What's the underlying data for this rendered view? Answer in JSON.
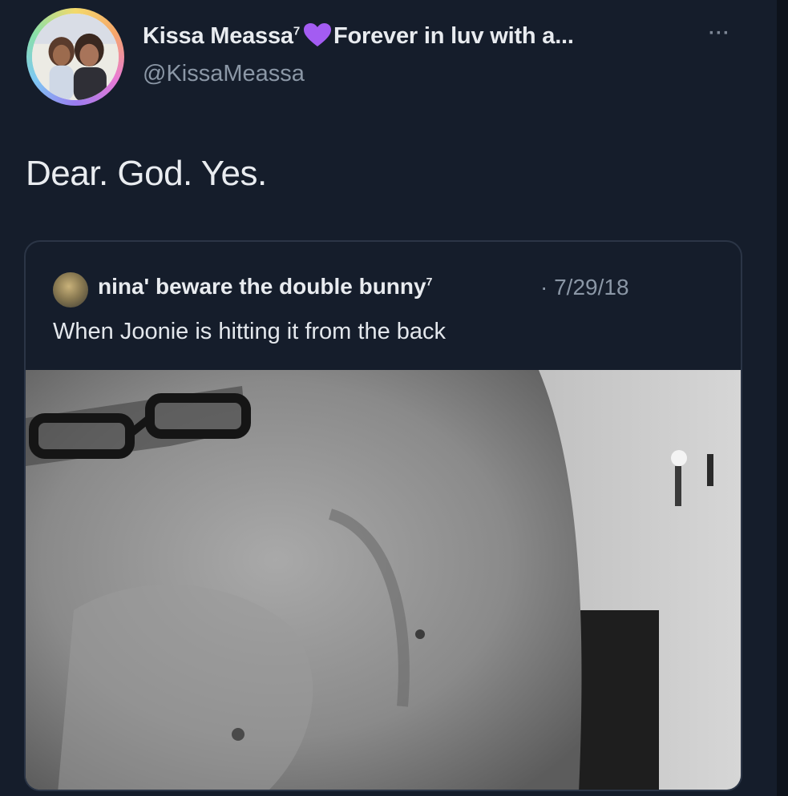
{
  "tweet": {
    "author": {
      "display_name": "Kissa Meassa",
      "name_superscript": "7",
      "bio_snippet": "Forever in luv with a...",
      "handle": "@KissaMeassa",
      "avatar_icon": "profile-photo",
      "heart_color": "#a35cf2"
    },
    "more_label": "···",
    "text": "Dear. God. Yes.",
    "quoted": {
      "author_name": "nina' beware the double bunny",
      "author_superscript": "7",
      "date": "· 7/29/18",
      "text": "When Joonie is hitting it from the back",
      "media_icon": "grayscale-photo"
    }
  },
  "colors": {
    "background": "#151d2b",
    "text_primary": "#e8ebef",
    "text_secondary": "#8b97a6",
    "card_border": "#2b3546"
  }
}
